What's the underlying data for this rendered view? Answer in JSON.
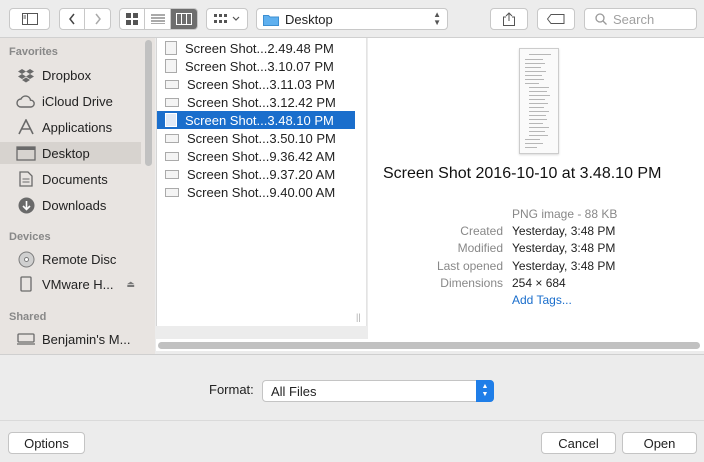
{
  "toolbar": {
    "path_folder": "Desktop",
    "search_placeholder": "Search"
  },
  "sidebar": {
    "favorites_header": "Favorites",
    "favorites": [
      {
        "label": "Dropbox",
        "icon": "dropbox-icon"
      },
      {
        "label": "iCloud Drive",
        "icon": "cloud-icon"
      },
      {
        "label": "Applications",
        "icon": "applications-icon"
      },
      {
        "label": "Desktop",
        "icon": "desktop-icon",
        "selected": true
      },
      {
        "label": "Documents",
        "icon": "document-icon"
      },
      {
        "label": "Downloads",
        "icon": "download-icon"
      }
    ],
    "devices_header": "Devices",
    "devices": [
      {
        "label": "Remote Disc",
        "icon": "disc-icon"
      },
      {
        "label": "VMware H...",
        "icon": "drive-icon",
        "ejectable": true
      }
    ],
    "shared_header": "Shared",
    "shared": [
      {
        "label": "Benjamin's M...",
        "icon": "computer-icon"
      }
    ]
  },
  "files": [
    {
      "name": "Screen Shot...2.49.48 PM"
    },
    {
      "name": "Screen Shot...3.10.07 PM"
    },
    {
      "name": "Screen Shot...3.11.03 PM"
    },
    {
      "name": "Screen Shot...3.12.42 PM"
    },
    {
      "name": "Screen Shot...3.48.10 PM",
      "selected": true
    },
    {
      "name": "Screen Shot...3.50.10 PM"
    },
    {
      "name": "Screen Shot...9.36.42 AM"
    },
    {
      "name": "Screen Shot...9.37.20 AM"
    },
    {
      "name": "Screen Shot...9.40.00 AM"
    }
  ],
  "preview": {
    "title": "Screen Shot 2016-10-10 at 3.48.10 PM",
    "kind": "PNG image - 88 KB",
    "created_label": "Created",
    "created": "Yesterday, 3:48 PM",
    "modified_label": "Modified",
    "modified": "Yesterday, 3:48 PM",
    "last_opened_label": "Last opened",
    "last_opened": "Yesterday, 3:48 PM",
    "dimensions_label": "Dimensions",
    "dimensions": "254 × 684",
    "add_tags": "Add Tags..."
  },
  "format": {
    "label": "Format:",
    "value": "All Files"
  },
  "buttons": {
    "options": "Options",
    "cancel": "Cancel",
    "open": "Open"
  },
  "colors": {
    "selection": "#1a6ecc",
    "link": "#1a6ecc",
    "popup_arrow": "#1f7ee8",
    "sidebar_bg": "#e8e4e1"
  }
}
